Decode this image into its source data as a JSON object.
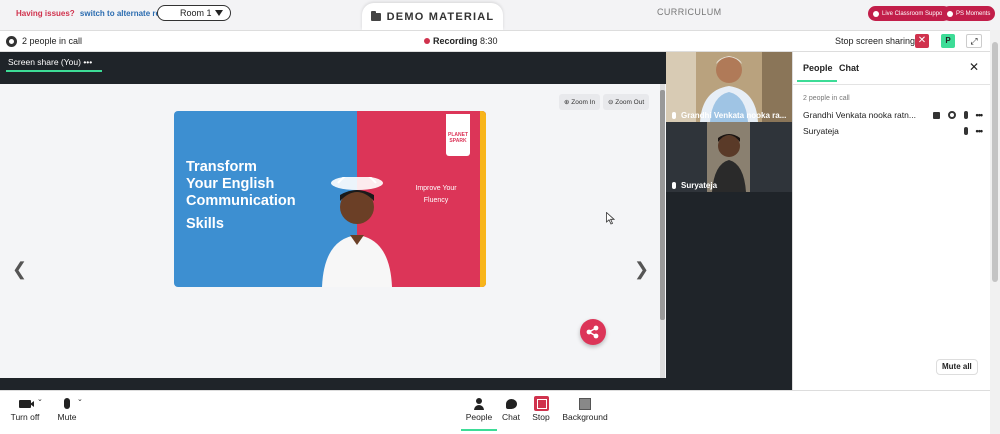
{
  "topbar": {
    "issues_question": "Having issues?",
    "issues_link": "switch to alternate room",
    "room_selected": "Room 1",
    "demo_tab": "DEMO MATERIAL",
    "curriculum_tab": "CURRICULUM",
    "live_support": "Live Classroom Support",
    "ps_moments": "PS Moments"
  },
  "callbar": {
    "people_count": "2 people in call",
    "recording_label": "Recording",
    "recording_time": "8:30",
    "stop_sharing": "Stop screen sharing",
    "participant_badge": "P"
  },
  "share": {
    "label": "Screen share (You)",
    "zoom_in": "Zoom In",
    "zoom_out": "Zoom Out",
    "slide_title_line1": "Transform",
    "slide_title_line2": "Your English",
    "slide_title_line3": "Communication",
    "slide_title_line4": "Skills",
    "slide_tagline": "Improve Your Fluency",
    "slide_logo": "PLANET SPARK"
  },
  "videos": [
    {
      "name": "Grandhi Venkata nooka ra..."
    },
    {
      "name": "Suryateja"
    }
  ],
  "panel": {
    "tab_people": "People",
    "tab_chat": "Chat",
    "people_count": "2 people in call",
    "participants": [
      {
        "name": "Grandhi Venkata nooka ratn..."
      },
      {
        "name": "Suryateja"
      }
    ],
    "mute_all": "Mute all"
  },
  "toolbar": {
    "turn_off": "Turn off",
    "mute": "Mute",
    "people": "People",
    "chat": "Chat",
    "stop": "Stop",
    "background": "Background"
  },
  "colors": {
    "accent_green": "#3ddc97",
    "brand_red": "#dc3558",
    "slide_blue": "#3d8fd1",
    "slide_yellow": "#f8b51a"
  }
}
